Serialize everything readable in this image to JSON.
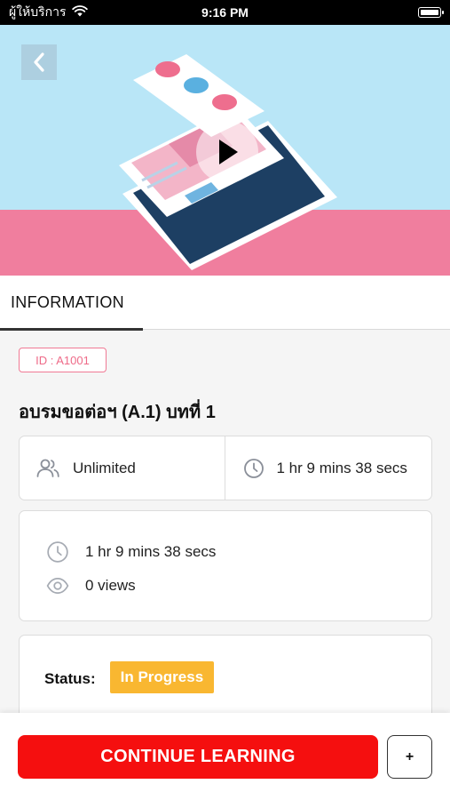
{
  "status_bar": {
    "carrier": "ผู้ให้บริการ",
    "time": "9:16 PM",
    "battery_level": 1.0
  },
  "hero": {
    "back_icon": "chevron-left-icon",
    "play_icon": "play-icon",
    "colors": {
      "sky": "#b9e6f7",
      "band": "#f07e9e"
    }
  },
  "tabs": [
    {
      "label": "INFORMATION",
      "active": true
    }
  ],
  "course": {
    "id_label": "ID : A1001",
    "title": "อบรมขอต่อฯ (A.1) บทที่ 1"
  },
  "info_row": {
    "seats": {
      "icon": "users-icon",
      "text": "Unlimited"
    },
    "duration": {
      "icon": "clock-icon",
      "text": "1 hr 9 mins 38 secs"
    }
  },
  "stats": {
    "duration": {
      "icon": "clock-icon",
      "text": "1 hr 9 mins 38 secs"
    },
    "views": {
      "icon": "eye-icon",
      "text": "0 views"
    }
  },
  "status": {
    "label": "Status:",
    "value": "In Progress",
    "color": "#f9b731"
  },
  "actions": {
    "primary_label": "CONTINUE LEARNING",
    "primary_color": "#f50f0f",
    "secondary_label": "+"
  }
}
